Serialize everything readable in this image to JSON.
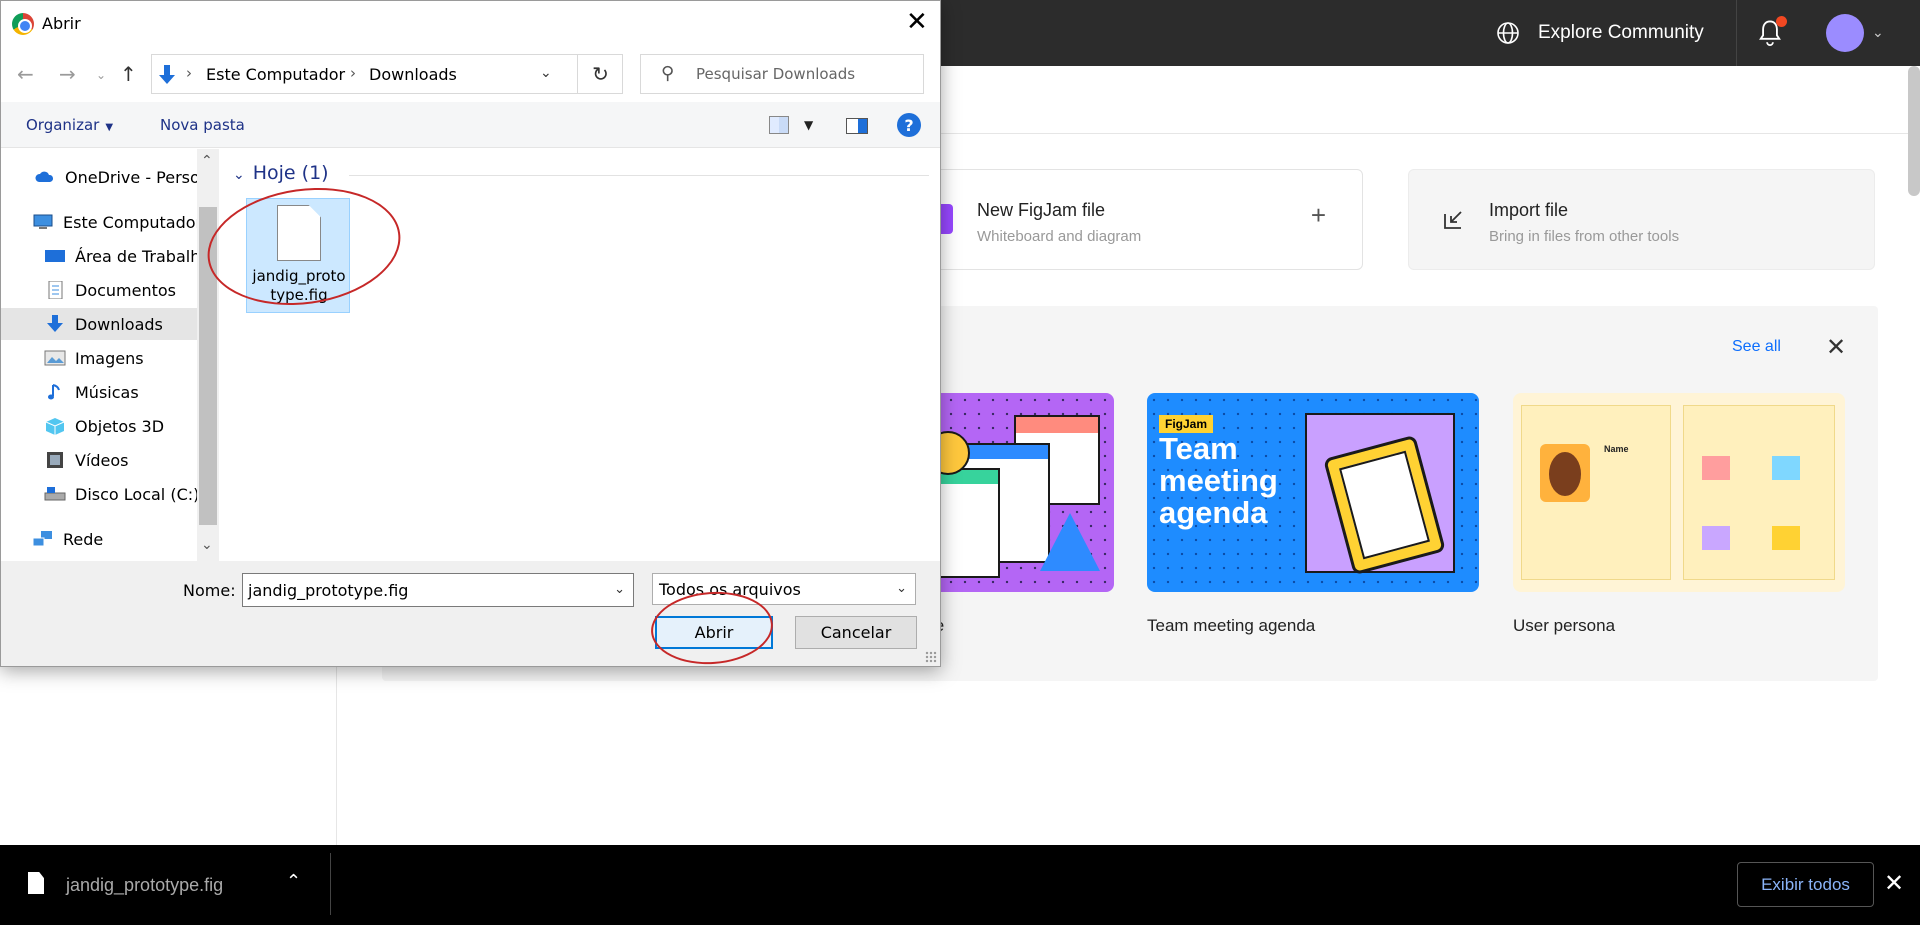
{
  "figma": {
    "topbar": {
      "explore_label": "Explore Community"
    },
    "create_cards": {
      "figjam": {
        "title": "New FigJam file",
        "subtitle": "Whiteboard and diagram"
      },
      "import": {
        "title": "Import file",
        "subtitle": "Bring in files from other tools"
      }
    },
    "templates": {
      "see_all": "See all",
      "items": [
        {
          "caption": "te"
        },
        {
          "caption": "Team meeting agenda",
          "badge": "FigJam",
          "thumb_title": "Team meeting agenda"
        },
        {
          "caption": "User persona",
          "thumb_name": "Name"
        }
      ]
    }
  },
  "download_bar": {
    "file_name": "jandig_prototype.fig",
    "show_all_label": "Exibir todos"
  },
  "dialog": {
    "title": "Abrir",
    "address": [
      "Este Computador",
      "Downloads"
    ],
    "search_placeholder": "Pesquisar Downloads",
    "toolbar": {
      "organize": "Organizar",
      "new_folder": "Nova pasta",
      "help": "?"
    },
    "nav_items": [
      {
        "label": "OneDrive - Personal",
        "icon": "onedrive-icon"
      },
      {
        "label": "Este Computador",
        "icon": "computer-icon"
      },
      {
        "label": "Área de Trabalho",
        "icon": "desktop-icon"
      },
      {
        "label": "Documentos",
        "icon": "documents-icon"
      },
      {
        "label": "Downloads",
        "icon": "downloads-icon",
        "selected": true
      },
      {
        "label": "Imagens",
        "icon": "images-icon"
      },
      {
        "label": "Músicas",
        "icon": "music-icon"
      },
      {
        "label": "Objetos 3D",
        "icon": "objects3d-icon"
      },
      {
        "label": "Vídeos",
        "icon": "videos-icon"
      },
      {
        "label": "Disco Local (C:)",
        "icon": "disk-icon"
      },
      {
        "label": "Rede",
        "icon": "network-icon"
      }
    ],
    "group_header": "Hoje (1)",
    "files": [
      {
        "name": "jandig_prototype.fig"
      }
    ],
    "name_label": "Nome:",
    "name_value": "jandig_prototype.fig",
    "file_type": "Todos os arquivos",
    "open_label": "Abrir",
    "cancel_label": "Cancelar"
  },
  "colors": {
    "accent": "#0078d7",
    "selection": "#cce8ff",
    "annotation": "#c62828",
    "figma_topbar": "#2c2c2c"
  }
}
